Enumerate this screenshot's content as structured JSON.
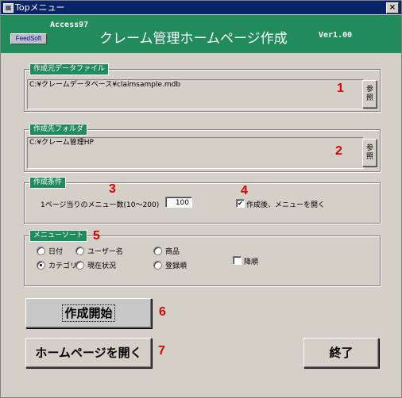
{
  "window": {
    "title": "Topメニュー",
    "close": "×"
  },
  "header": {
    "access": "Access97",
    "feedsoft": "FeedSoft",
    "title": "クレーム管理ホームページ作成",
    "version": "Ver1.00"
  },
  "source_file": {
    "label": "作成元データファイル",
    "value": "C:¥クレームデータベース¥claimsample.mdb",
    "browse": "参照"
  },
  "dest_folder": {
    "label": "作成先フォルダ",
    "value": "C:¥クレーム管理HP",
    "browse": "参照"
  },
  "conditions": {
    "label": "作成条件",
    "per_page_label": "1ページ当りのメニュー数(10〜200)",
    "per_page_value": "100",
    "open_menu_label": "作成後、メニューを開く",
    "open_menu_checked": true,
    "check_mark": "✔"
  },
  "sort": {
    "label": "メニューソート",
    "options": [
      "日付",
      "ユーザー名",
      "商品",
      "カテゴリ",
      "現在状況",
      "登録順"
    ],
    "selected": "カテゴリ",
    "descending_label": "降順"
  },
  "buttons": {
    "start": "作成開始",
    "open_homepage": "ホームページを開く",
    "exit": "終了"
  },
  "callouts": [
    "1",
    "2",
    "3",
    "4",
    "5",
    "6",
    "7"
  ]
}
